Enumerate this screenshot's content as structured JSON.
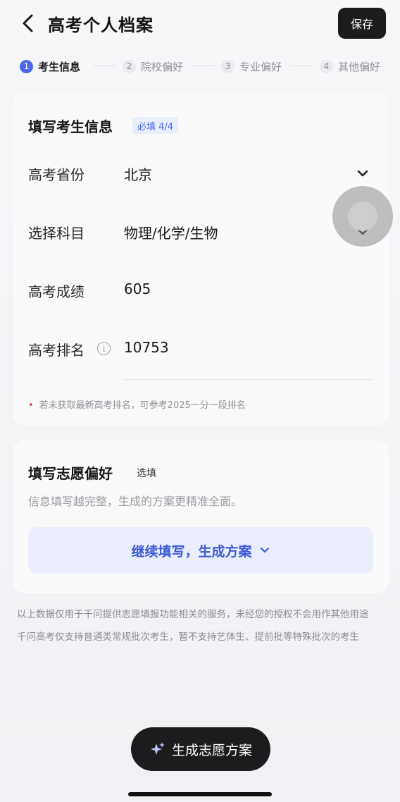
{
  "header": {
    "title": "高考个人档案",
    "save_label": "保存"
  },
  "steps": [
    {
      "num": "1",
      "label": "考生信息"
    },
    {
      "num": "2",
      "label": "院校偏好"
    },
    {
      "num": "3",
      "label": "专业偏好"
    },
    {
      "num": "4",
      "label": "其他偏好"
    }
  ],
  "student_card": {
    "title": "填写考生信息",
    "badge": "必填 4/4",
    "fields": [
      {
        "label": "高考省份",
        "value": "北京"
      },
      {
        "label": "选择科目",
        "value": "物理/化学/生物"
      },
      {
        "label": "高考成绩",
        "value": "605"
      },
      {
        "label": "高考排名",
        "value": "10753"
      }
    ],
    "note_dot": "•",
    "note": "若未获取最新高考排名，可参考2025一分一段排名"
  },
  "preference_card": {
    "title": "填写志愿偏好",
    "badge": "选填",
    "description": "信息填写越完整，生成的方案更精准全面。",
    "continue_label": "继续填写，生成方案"
  },
  "footer": {
    "line1": "以上数据仅用于千问提供志愿填报功能相关的服务，未经您的授权不会用作其他用途",
    "line2": "千问高考仅支持普通类常规批次考生，暂不支持艺体生、提前批等特殊批次的考生"
  },
  "generate_label": "生成志愿方案",
  "icons": {
    "back": "chevron-left-icon",
    "chevron": "chevron-down-icon",
    "info": "info-icon",
    "sparkle": "sparkle-icon"
  },
  "colors": {
    "accent": "#4a68e8",
    "dark_button": "#1c1c1e",
    "required_dot": "#e14b4b"
  }
}
